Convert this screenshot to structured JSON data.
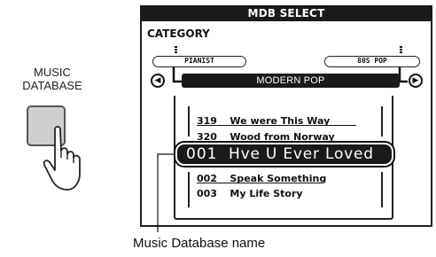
{
  "button_label_line1": "MUSIC",
  "button_label_line2": "DATABASE",
  "lcd": {
    "title": "MDB SELECT",
    "category_heading": "CATEGORY",
    "prev_category": "PIANIST",
    "next_category": "80S POP",
    "current_category": "MODERN POP",
    "prev_arrow": "◀",
    "next_arrow": "▶",
    "songs_above": [
      {
        "number": "319",
        "title": "We were This Way"
      },
      {
        "number": "320",
        "title": "Wood from Norway"
      }
    ],
    "selected_song": {
      "number": "001",
      "title": "Hve U Ever Loved"
    },
    "songs_below": [
      {
        "number": "002",
        "title": "Speak Something"
      },
      {
        "number": "003",
        "title": "My Life Story"
      }
    ]
  },
  "callout": "Music Database name",
  "icons": {
    "hand": "pressing-hand-icon",
    "prev": "double-left-arrow-icon",
    "next": "double-right-arrow-icon"
  }
}
